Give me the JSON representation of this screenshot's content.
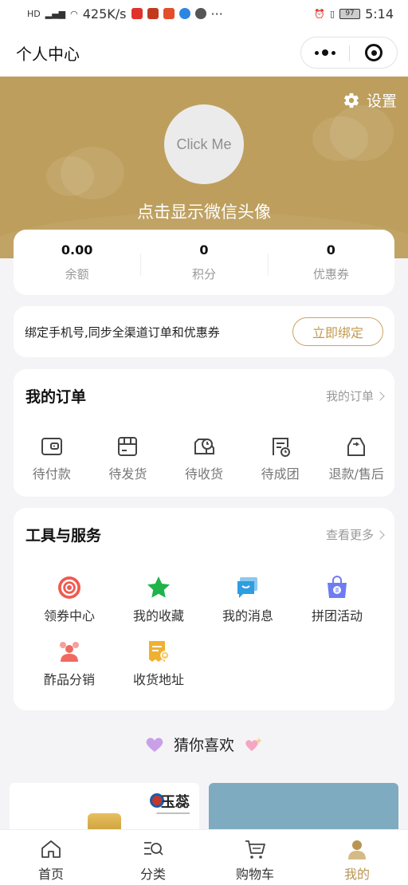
{
  "status_bar": {
    "network": "425K/s",
    "more": "···",
    "battery": "97",
    "time": "5:14"
  },
  "title_bar": {
    "title": "个人中心"
  },
  "profile": {
    "settings_label": "设置",
    "avatar_text": "Click Me",
    "avatar_hint": "点击显示微信头像"
  },
  "stats": [
    {
      "value": "0.00",
      "label": "余额"
    },
    {
      "value": "0",
      "label": "积分"
    },
    {
      "value": "0",
      "label": "优惠券"
    }
  ],
  "bind": {
    "text": "绑定手机号,同步全渠道订单和优惠券",
    "button": "立即绑定"
  },
  "orders": {
    "title": "我的订单",
    "more": "我的订单",
    "items": [
      {
        "label": "待付款",
        "icon": "wallet-icon"
      },
      {
        "label": "待发货",
        "icon": "box-icon"
      },
      {
        "label": "待收货",
        "icon": "truck-icon"
      },
      {
        "label": "待成团",
        "icon": "group-icon"
      },
      {
        "label": "退款/售后",
        "icon": "refund-icon"
      }
    ]
  },
  "tools": {
    "title": "工具与服务",
    "more": "查看更多",
    "items": [
      {
        "label": "领券中心",
        "icon": "coupon-icon",
        "color": "#f05a50"
      },
      {
        "label": "我的收藏",
        "icon": "star-icon",
        "color": "#1fb34a"
      },
      {
        "label": "我的消息",
        "icon": "message-icon",
        "color": "#2f9de0"
      },
      {
        "label": "拼团活动",
        "icon": "bag-icon",
        "color": "#6f7cf0"
      },
      {
        "label": "酢品分销",
        "icon": "people-icon",
        "color": "#f06a60"
      },
      {
        "label": "收货地址",
        "icon": "address-icon",
        "color": "#f0b030"
      }
    ]
  },
  "guess": {
    "title": "猜你喜欢"
  },
  "products": {
    "brand": "玉蕊"
  },
  "tab_bar": [
    {
      "label": "首页",
      "icon": "home-icon",
      "active": false
    },
    {
      "label": "分类",
      "icon": "category-icon",
      "active": false
    },
    {
      "label": "购物车",
      "icon": "cart-icon",
      "active": false
    },
    {
      "label": "我的",
      "icon": "profile-icon",
      "active": true
    }
  ],
  "colors": {
    "gold": "#bd9e5c",
    "accent": "#c29a4e",
    "background": "#f4f4f6"
  }
}
